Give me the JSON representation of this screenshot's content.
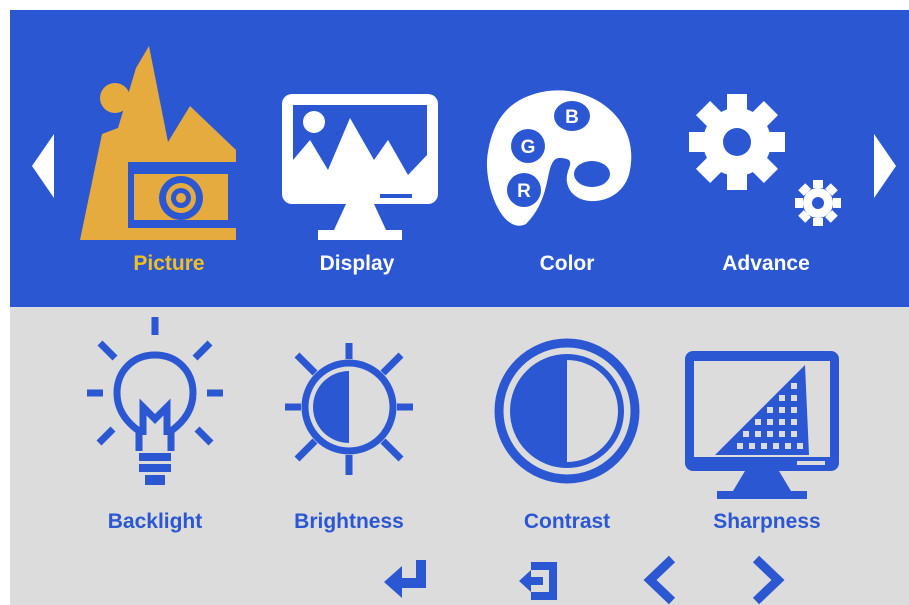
{
  "menu": {
    "tabs": [
      {
        "label": "Picture",
        "icon": "picture-icon",
        "selected": true
      },
      {
        "label": "Display",
        "icon": "display-icon",
        "selected": false
      },
      {
        "label": "Color",
        "icon": "color-palette-icon",
        "selected": false
      },
      {
        "label": "Advance",
        "icon": "gear-icon",
        "selected": false
      }
    ],
    "prev_tab_icon": "triangle-left-icon",
    "next_tab_icon": "triangle-right-icon"
  },
  "submenu": {
    "items": [
      {
        "label": "Backlight",
        "icon": "lightbulb-icon"
      },
      {
        "label": "Brightness",
        "icon": "sun-icon"
      },
      {
        "label": "Contrast",
        "icon": "contrast-icon"
      },
      {
        "label": "Sharpness",
        "icon": "sharpness-icon"
      }
    ]
  },
  "palette_icon_letters": [
    "B",
    "G",
    "R"
  ],
  "nav_buttons": [
    {
      "icon": "enter-icon"
    },
    {
      "icon": "exit-icon"
    },
    {
      "icon": "chevron-left-icon"
    },
    {
      "icon": "chevron-right-icon"
    }
  ],
  "colors": {
    "header_blue": "#2B57D3",
    "body_grey": "#DCDCDC",
    "selected_gold": "#F0C020",
    "white": "#FFFFFF"
  }
}
